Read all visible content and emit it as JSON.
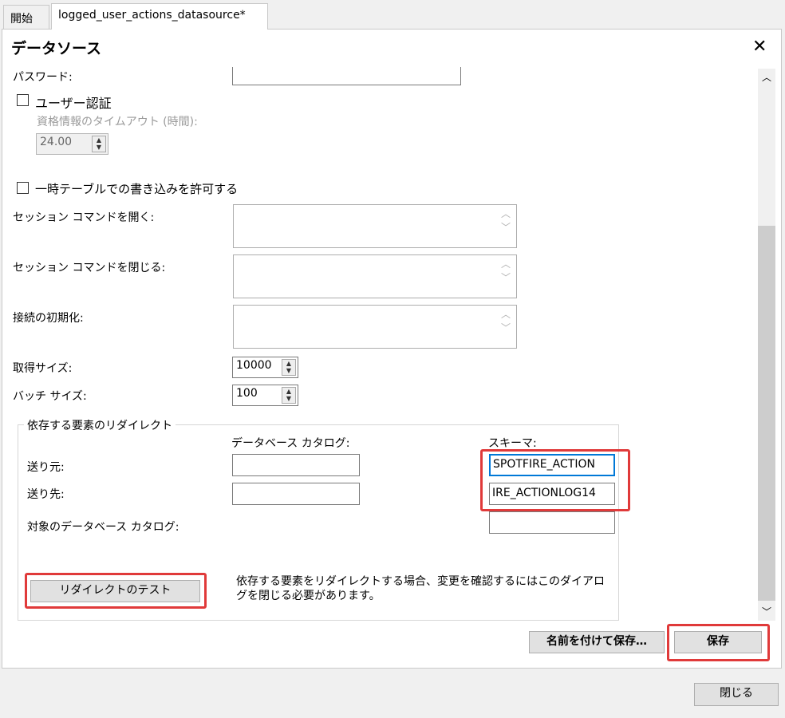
{
  "tabs": [
    {
      "label": "開始"
    },
    {
      "label": "logged_user_actions_datasource*"
    }
  ],
  "dialog": {
    "title": "データソース",
    "close_glyph": "✕"
  },
  "form": {
    "password_label": "パスワード:",
    "user_auth_label": "ユーザー認証",
    "credential_timeout_label": "資格情報のタイムアウト (時間):",
    "credential_timeout_value": "24.00",
    "allow_temp_tables_label": "一時テーブルでの書き込みを許可する",
    "open_session_label": "セッション コマンドを開く:",
    "close_session_label": "セッション コマンドを閉じる:",
    "connection_init_label": "接続の初期化:",
    "fetch_size_label": "取得サイズ:",
    "fetch_size_value": "10000",
    "batch_size_label": "バッチ サイズ:",
    "batch_size_value": "100"
  },
  "redirect": {
    "group_title": "依存する要素のリダイレクト",
    "db_catalog_header": "データベース カタログ:",
    "schema_header": "スキーマ:",
    "from_label": "送り元:",
    "to_label": "送り先:",
    "target_catalog_label": "対象のデータベース カタログ:",
    "from_schema_value": "SPOTFIRE_ACTION",
    "to_schema_value": "IRE_ACTIONLOG14",
    "test_button": "リダイレクトのテスト",
    "note": "依存する要素をリダイレクトする場合、変更を確認するにはこのダイアログを閉じる必要があります。"
  },
  "buttons": {
    "save_as": "名前を付けて保存…",
    "save": "保存",
    "close": "閉じる"
  },
  "colors": {
    "highlight": "#e03a3a",
    "focus_border": "#0078d7"
  }
}
